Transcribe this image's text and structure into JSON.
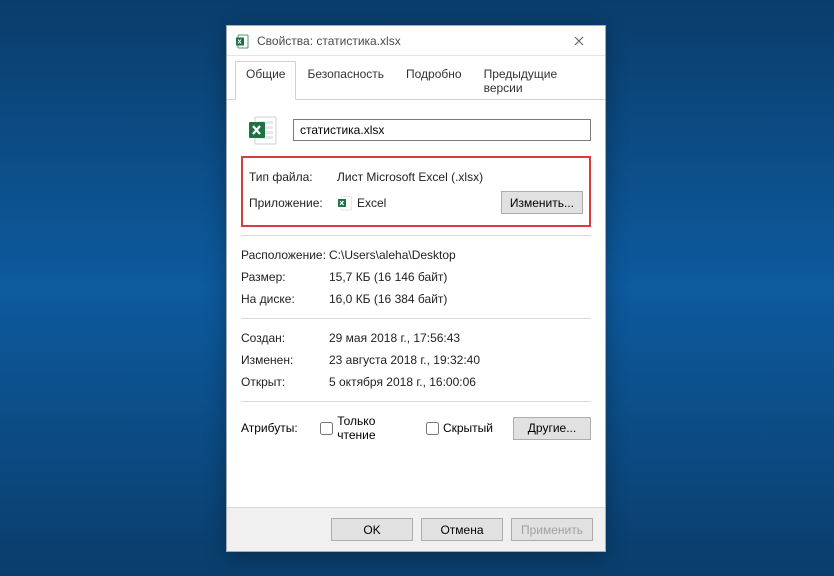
{
  "titlebar": {
    "title": "Свойства: статистика.xlsx"
  },
  "tabs": {
    "items": [
      {
        "label": "Общие",
        "active": true
      },
      {
        "label": "Безопасность",
        "active": false
      },
      {
        "label": "Подробно",
        "active": false
      },
      {
        "label": "Предыдущие версии",
        "active": false
      }
    ]
  },
  "file": {
    "name": "статистика.xlsx"
  },
  "info": {
    "type_label": "Тип файла:",
    "type_value": "Лист Microsoft Excel (.xlsx)",
    "app_label": "Приложение:",
    "app_value": "Excel",
    "change_button": "Изменить..."
  },
  "location": {
    "label": "Расположение:",
    "value": "C:\\Users\\aleha\\Desktop"
  },
  "size": {
    "label": "Размер:",
    "value": "15,7 КБ (16 146 байт)"
  },
  "ondisk": {
    "label": "На диске:",
    "value": "16,0 КБ (16 384 байт)"
  },
  "created": {
    "label": "Создан:",
    "value": "29 мая 2018 г., 17:56:43"
  },
  "modified": {
    "label": "Изменен:",
    "value": "23 августа 2018 г., 19:32:40"
  },
  "accessed": {
    "label": "Открыт:",
    "value": "5 октября 2018 г., 16:00:06"
  },
  "attributes": {
    "label": "Атрибуты:",
    "readonly": "Только чтение",
    "hidden": "Скрытый",
    "other_button": "Другие..."
  },
  "footer": {
    "ok": "OK",
    "cancel": "Отмена",
    "apply": "Применить"
  }
}
